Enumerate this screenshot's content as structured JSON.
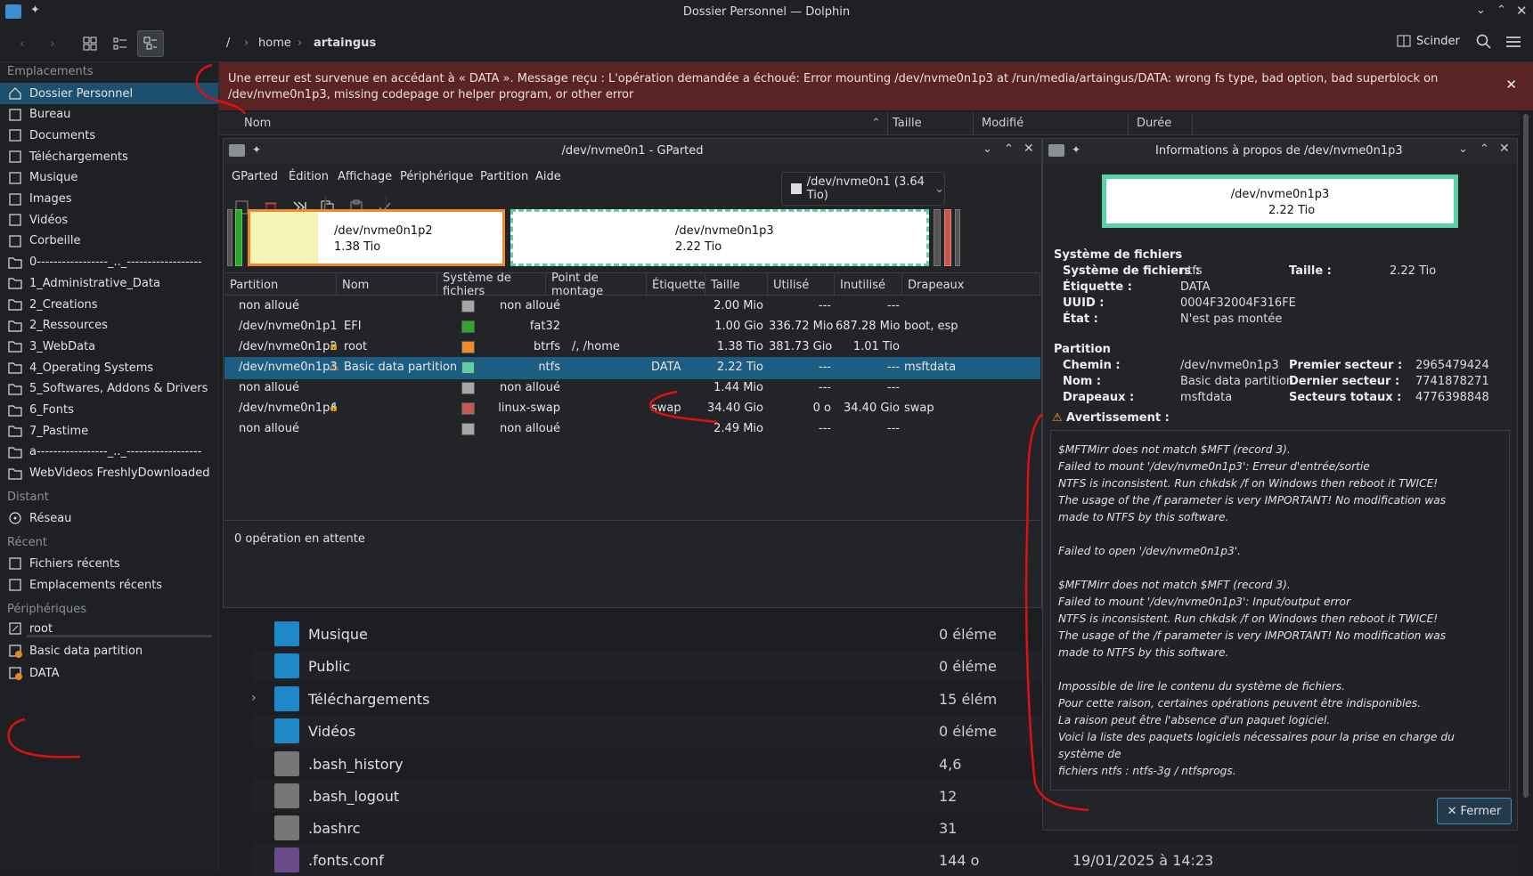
{
  "window": {
    "title": "Dossier Personnel — Dolphin"
  },
  "breadcrumb": [
    "/",
    "home",
    "artaingus"
  ],
  "toolbar": {
    "split_label": "Scinder"
  },
  "sidebar": {
    "sections": [
      "Emplacements",
      "Distant",
      "Récent",
      "Périphériques"
    ],
    "places": [
      "Dossier Personnel",
      "Bureau",
      "Documents",
      "Téléchargements",
      "Musique",
      "Images",
      "Vidéos",
      "Corbeille",
      "0-----------------_.._------------------",
      "1_Administrative_Data",
      "2_Creations",
      "2_Ressources",
      "3_WebData",
      "4_Operating Systems",
      "5_Softwares, Addons & Drivers",
      "6_Fonts",
      "7_Pastime",
      "a-----------------_.._------------------",
      "WebVideos FreshlyDownloaded"
    ],
    "remote": [
      "Réseau"
    ],
    "recent": [
      "Fichiers récents",
      "Emplacements récents"
    ],
    "devices": [
      "root",
      "Basic data partition",
      "DATA"
    ]
  },
  "error_banner": {
    "text": "Une erreur est survenue en accédant à « DATA ». Message reçu : L'opération demandée a échoué: Error mounting /dev/nvme0n1p3 at /run/media/artaingus/DATA: wrong fs type, bad option, bad superblock on /dev/nvme0n1p3, missing codepage or helper program, or other error"
  },
  "file_view": {
    "columns": [
      "Nom",
      "Taille",
      "Modifié",
      "Durée"
    ],
    "rows": [
      {
        "name": "Musique",
        "size": "0 éléme",
        "date": ""
      },
      {
        "name": "Public",
        "size": "0 éléme",
        "date": ""
      },
      {
        "name": "Téléchargements",
        "size": "15 élém",
        "date": ""
      },
      {
        "name": "Vidéos",
        "size": "0 éléme",
        "date": ""
      },
      {
        "name": ".bash_history",
        "size": "4,6",
        "date": ""
      },
      {
        "name": ".bash_logout",
        "size": "12",
        "date": ""
      },
      {
        "name": ".bashrc",
        "size": "31",
        "date": ""
      },
      {
        "name": ".fonts.conf",
        "size": "144 o",
        "date": "19/01/2025 à 14:23"
      }
    ]
  },
  "gparted": {
    "title": "/dev/nvme0n1 - GParted",
    "menu": [
      "GParted",
      "Édition",
      "Affichage",
      "Périphérique",
      "Partition",
      "Aide"
    ],
    "device_selector": "/dev/nvme0n1 (3.64 Tio)",
    "diskmap": [
      {
        "name": "/dev/nvme0n1p2",
        "size": "1.38 Tio"
      },
      {
        "name": "/dev/nvme0n1p3",
        "size": "2.22 Tio"
      }
    ],
    "columns": [
      "Partition",
      "Nom",
      "Système de fichiers",
      "Point de montage",
      "Étiquette",
      "Taille",
      "Utilisé",
      "Inutilisé",
      "Drapeaux"
    ],
    "rows": [
      {
        "partition": "non alloué",
        "name": "",
        "fs": "non alloué",
        "color": "#a6a6a6",
        "mount": "",
        "label": "",
        "size": "2.00 Mio",
        "used": "---",
        "unused": "---",
        "flags": ""
      },
      {
        "partition": "/dev/nvme0n1p1",
        "name": "EFI",
        "fs": "fat32",
        "color": "#2fa42f",
        "mount": "",
        "label": "",
        "size": "1.00 Gio",
        "used": "336.72 Mio",
        "unused": "687.28 Mio",
        "flags": "boot, esp"
      },
      {
        "partition": "/dev/nvme0n1p2",
        "name": "root",
        "fs": "btrfs",
        "color": "#f2892b",
        "mount": "/, /home",
        "label": "",
        "size": "1.38 Tio",
        "used": "381.73 Gio",
        "unused": "1.01 Tio",
        "flags": ""
      },
      {
        "partition": "/dev/nvme0n1p3",
        "name": "Basic data partition",
        "fs": "ntfs",
        "color": "#5cd1a8",
        "mount": "",
        "label": "DATA",
        "size": "2.22 Tio",
        "used": "---",
        "unused": "---",
        "flags": "msftdata"
      },
      {
        "partition": "non alloué",
        "name": "",
        "fs": "non alloué",
        "color": "#a6a6a6",
        "mount": "",
        "label": "",
        "size": "1.44 Mio",
        "used": "---",
        "unused": "---",
        "flags": ""
      },
      {
        "partition": "/dev/nvme0n1p4",
        "name": "",
        "fs": "linux-swap",
        "color": "#c15a53",
        "mount": "",
        "label": "swap",
        "size": "34.40 Gio",
        "used": "0 o",
        "unused": "34.40 Gio",
        "flags": "swap"
      },
      {
        "partition": "non alloué",
        "name": "",
        "fs": "non alloué",
        "color": "#a6a6a6",
        "mount": "",
        "label": "",
        "size": "2.49 Mio",
        "used": "---",
        "unused": "---",
        "flags": ""
      }
    ],
    "status": "0 opération en attente"
  },
  "info": {
    "title": "Informations à propos de /dev/nvme0n1p3",
    "header_name": "/dev/nvme0n1p3",
    "header_size": "2.22 Tio",
    "fs_section": "Système de fichiers",
    "fs_label": "Système de fichiers :",
    "fs_value": "ntfs",
    "size_label": "Taille :",
    "size_value": "2.22 Tio",
    "tag_label": "Étiquette :",
    "tag_value": "DATA",
    "uuid_label": "UUID :",
    "uuid_value": "0004F32004F316FE",
    "state_label": "État :",
    "state_value": "N'est pas montée",
    "part_section": "Partition",
    "path_label": "Chemin :",
    "path_value": "/dev/nvme0n1p3",
    "name_label": "Nom :",
    "name_value": "Basic data partition",
    "flags_label": "Drapeaux :",
    "flags_value": "msftdata",
    "first_label": "Premier secteur :",
    "first_value": "2965479424",
    "last_label": "Dernier secteur :",
    "last_value": "7741878271",
    "total_label": "Secteurs totaux :",
    "total_value": "4776398848",
    "warn_label": "Avertissement :",
    "warning_text": "$MFTMirr does not match $MFT (record 3).\nFailed to mount '/dev/nvme0n1p3': Erreur d'entrée/sortie\nNTFS is inconsistent. Run chkdsk /f on Windows then reboot it TWICE!\nThe usage of the /f parameter is very IMPORTANT! No modification was\nmade to NTFS by this software.\n\nFailed to open '/dev/nvme0n1p3'.\n\n$MFTMirr does not match $MFT (record 3).\nFailed to mount '/dev/nvme0n1p3': Input/output error\nNTFS is inconsistent. Run chkdsk /f on Windows then reboot it TWICE!\nThe usage of the /f parameter is very IMPORTANT! No modification was\nmade to NTFS by this software.\n\nImpossible de lire le contenu du système de fichiers.\nPour cette raison, certaines opérations peuvent être indisponibles.\nLa raison peut être l'absence d'un paquet logiciel.\nVoici la liste des paquets logiciels nécessaires pour la prise en charge du système de\nfichiers ntfs : ntfs-3g / ntfsprogs.",
    "close_label": "Fermer"
  }
}
